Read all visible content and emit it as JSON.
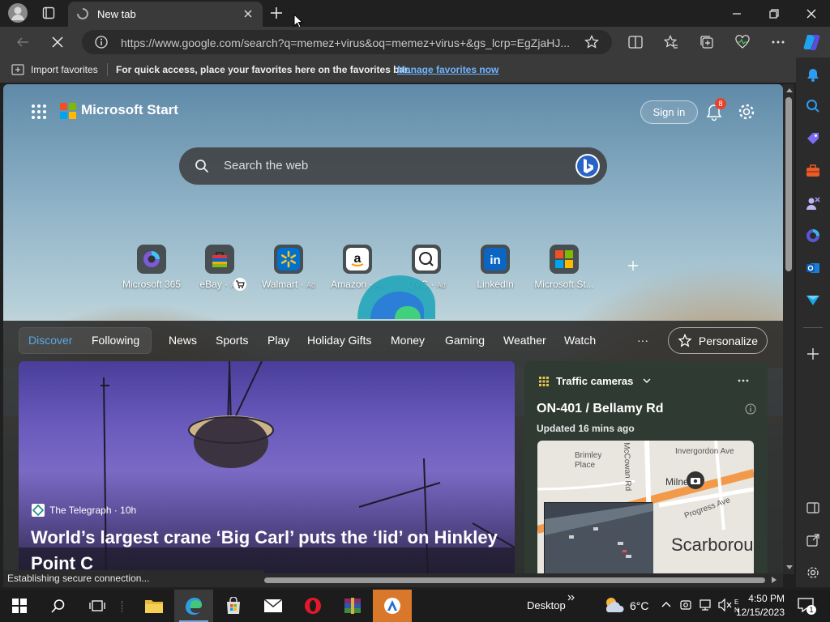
{
  "browser": {
    "tab_title": "New tab",
    "address_url": "https://www.google.com/search?q=memez+virus&oq=memez+virus+&gs_lcrp=EgZjaHJ...",
    "status_text": "Establishing secure connection..."
  },
  "favorites_bar": {
    "import_label": "Import favorites",
    "hint_text": "For quick access, place your favorites here on the favorites bar.",
    "manage_link": "Manage favorites now"
  },
  "start": {
    "brand": "Microsoft Start",
    "sign_in": "Sign in",
    "notification_count": "8",
    "search_placeholder": "Search the web",
    "tiles": [
      {
        "label": "Microsoft 365",
        "ad": ""
      },
      {
        "label": "eBay",
        "ad": "Ad"
      },
      {
        "label": "Walmart",
        "ad": "Ad"
      },
      {
        "label": "Amazon",
        "ad": "Ad"
      },
      {
        "label": "QVC",
        "ad": "Ad"
      },
      {
        "label": "LinkedIn",
        "ad": ""
      },
      {
        "label": "Microsoft St...",
        "ad": ""
      }
    ]
  },
  "feed_nav": {
    "items": [
      "Discover",
      "Following",
      "News",
      "Sports",
      "Play",
      "Holiday Gifts",
      "Money",
      "Gaming",
      "Weather",
      "Watch",
      "···"
    ],
    "personalize": "Personalize"
  },
  "hero": {
    "source": "The Telegraph · 10h",
    "title": "World’s largest crane ‘Big Carl’ puts the ‘lid’ on Hinkley Point C"
  },
  "traffic_card": {
    "header": "Traffic cameras",
    "title": "ON-401 / Bellamy Rd",
    "updated": "Updated 16 mins ago",
    "map_labels": [
      "Brimley Place",
      "Invergordon Ave",
      "McCowan Rd",
      "Milner",
      "Progress Ave",
      "Scarborou"
    ]
  },
  "taskbar": {
    "desktop_label": "Desktop",
    "temperature": "6°C",
    "time": "4:50 PM",
    "date": "12/15/2023",
    "notification_badge": "1"
  },
  "colors": {
    "accent_blue": "#5aa9e6",
    "link_blue": "#6fb5ff",
    "notification_red": "#e3442e"
  }
}
